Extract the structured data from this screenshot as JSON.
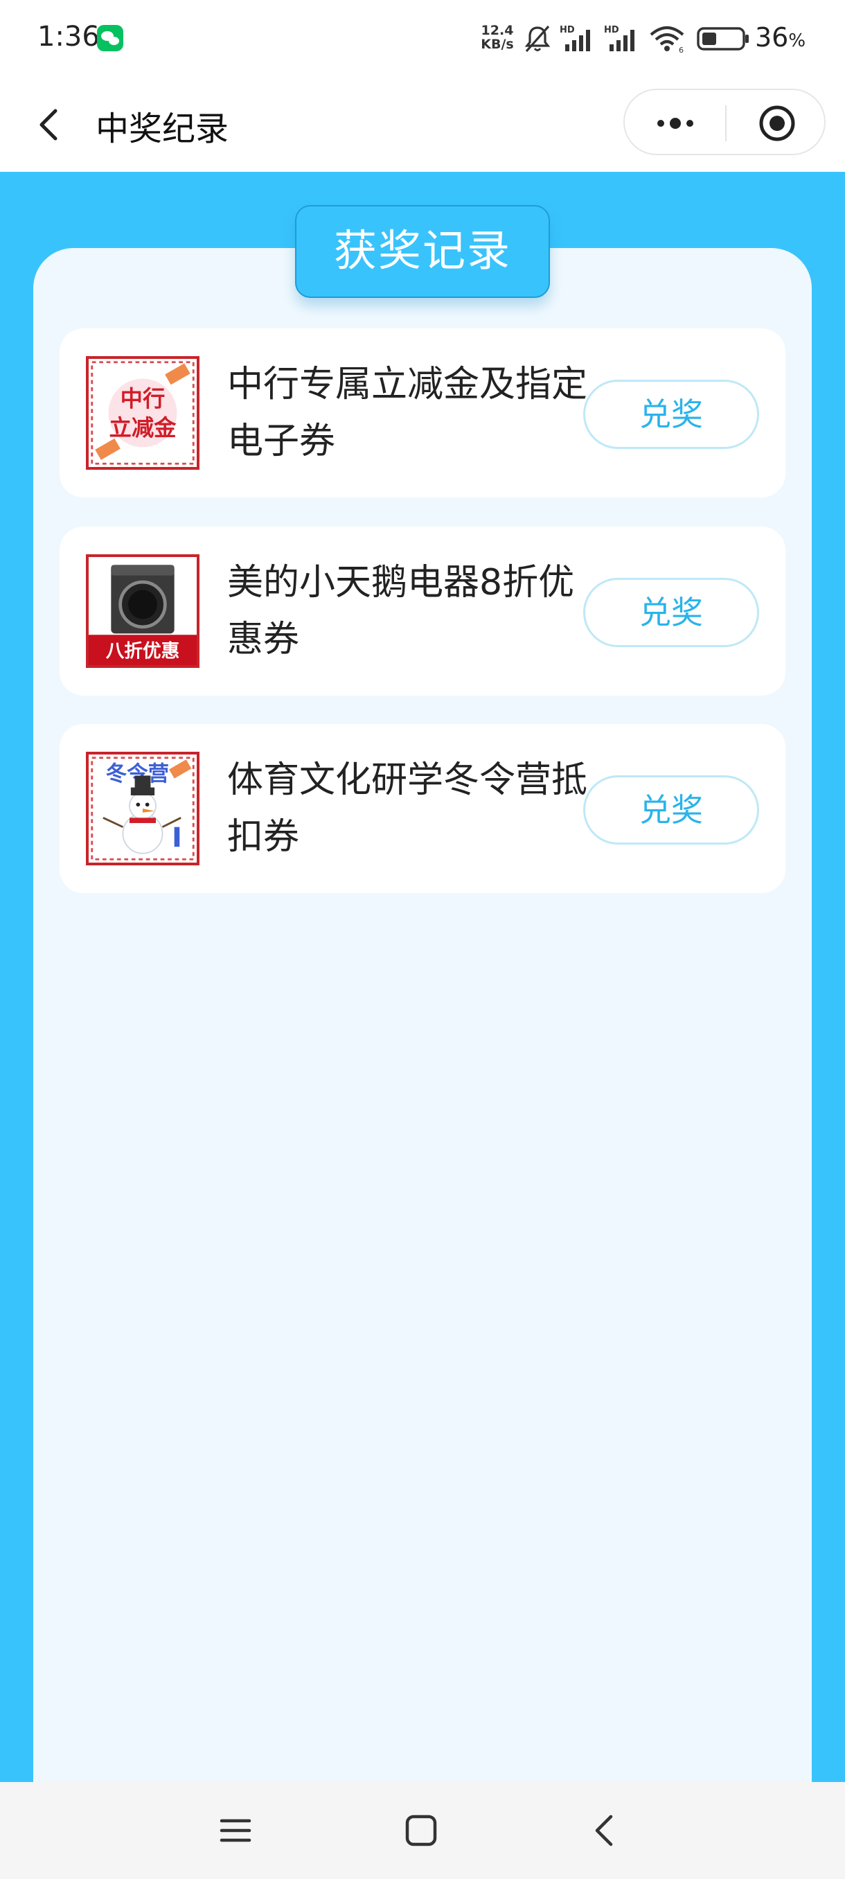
{
  "status_bar": {
    "time": "1:36",
    "net_speed_value": "12.4",
    "net_speed_unit": "KB/s",
    "battery_percent": "36",
    "battery_unit": "%",
    "battery_level": 0.36
  },
  "nav": {
    "title": "中奖纪录"
  },
  "header": {
    "badge_label": "获奖记录"
  },
  "prizes": [
    {
      "name": "中行专属立减金及指定电子券",
      "thumb_text": [
        "中行",
        "立减金"
      ],
      "button_label": "兑奖"
    },
    {
      "name": "美的小天鹅电器8折优惠券",
      "thumb_text": [
        "八折优惠"
      ],
      "button_label": "兑奖"
    },
    {
      "name": "体育文化研学冬令营抵扣券",
      "thumb_text": [
        "冬令营"
      ],
      "button_label": "兑奖"
    }
  ],
  "colors": {
    "accent": "#39c3fc",
    "panel": "#eff8fe",
    "button_text": "#2ab3ea",
    "thumb_border": "#c8242b"
  }
}
